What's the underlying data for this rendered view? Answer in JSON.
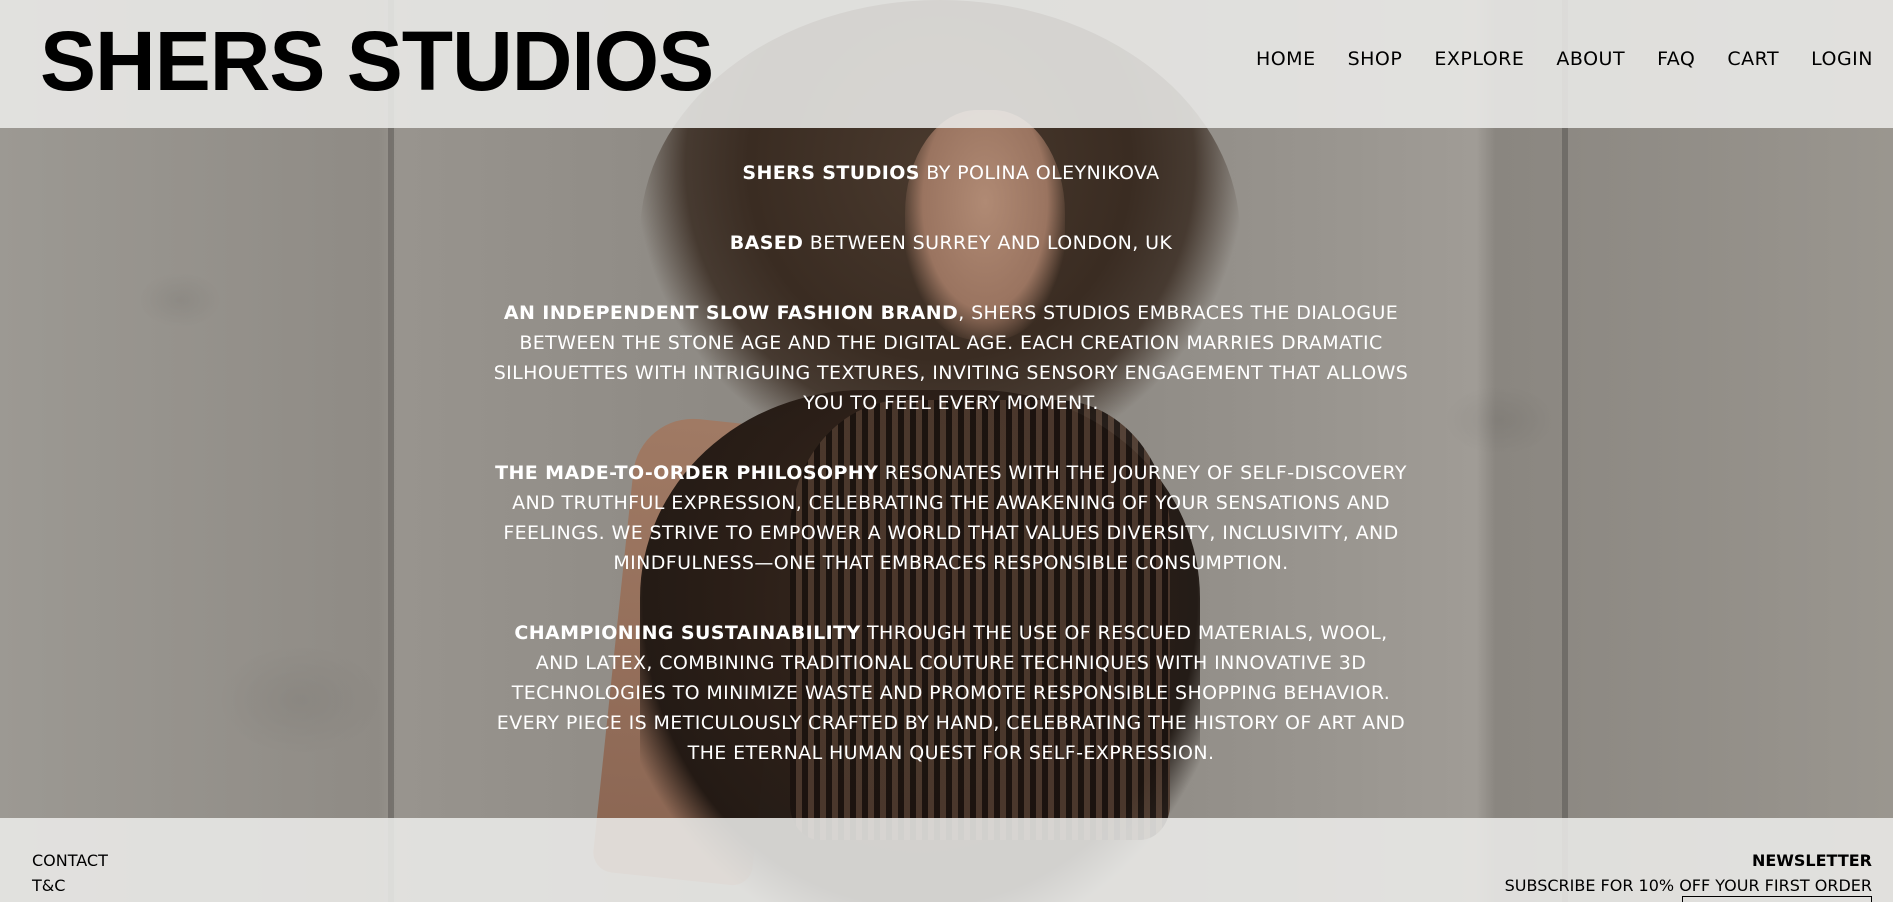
{
  "header": {
    "logo": "SHERS STUDIOS",
    "nav": [
      "HOME",
      "SHOP",
      "EXPLORE",
      "ABOUT",
      "FAQ",
      "CART",
      "LOGIN"
    ]
  },
  "content": {
    "p1_bold": "SHERS STUDIOS",
    "p1_text": " BY POLINA OLEYNIKOVA",
    "p2_bold": "BASED",
    "p2_text": " BETWEEN SURREY AND LONDON, UK",
    "p3_bold": "AN INDEPENDENT SLOW FASHION BRAND",
    "p3_text": ", SHERS STUDIOS EMBRACES THE DIALOGUE BETWEEN THE STONE AGE AND THE DIGITAL AGE. EACH CREATION MARRIES DRAMATIC SILHOUETTES WITH INTRIGUING TEXTURES, INVITING SENSORY ENGAGEMENT THAT ALLOWS YOU TO FEEL EVERY MOMENT.",
    "p4_bold": "THE MADE-TO-ORDER PHILOSOPHY",
    "p4_text": " RESONATES WITH THE JOURNEY OF SELF-DISCOVERY AND TRUTHFUL EXPRESSION, CELEBRATING THE AWAKENING OF YOUR SENSATIONS AND FEELINGS. WE STRIVE TO EMPOWER A WORLD THAT VALUES DIVERSITY, INCLUSIVITY, AND MINDFULNESS—ONE THAT EMBRACES RESPONSIBLE CONSUMPTION.",
    "p5_bold": "CHAMPIONING SUSTAINABILITY",
    "p5_text": " THROUGH THE USE OF RESCUED MATERIALS, WOOL, AND LATEX, COMBINING TRADITIONAL COUTURE TECHNIQUES WITH INNOVATIVE 3D TECHNOLOGIES TO MINIMIZE WASTE AND PROMOTE RESPONSIBLE SHOPPING BEHAVIOR. EVERY PIECE IS METICULOUSLY CRAFTED BY HAND, CELEBRATING THE HISTORY OF ART AND THE ETERNAL HUMAN QUEST FOR SELF-EXPRESSION."
  },
  "footer": {
    "links": [
      "CONTACT",
      "T&C"
    ],
    "newsletter_title": "NEWSLETTER",
    "newsletter_sub": "SUBSCRIBE FOR 10% OFF YOUR FIRST ORDER"
  },
  "colors": {
    "header_bg": "#ebeae8",
    "text_dark": "#000000",
    "text_light": "#ffffff"
  }
}
